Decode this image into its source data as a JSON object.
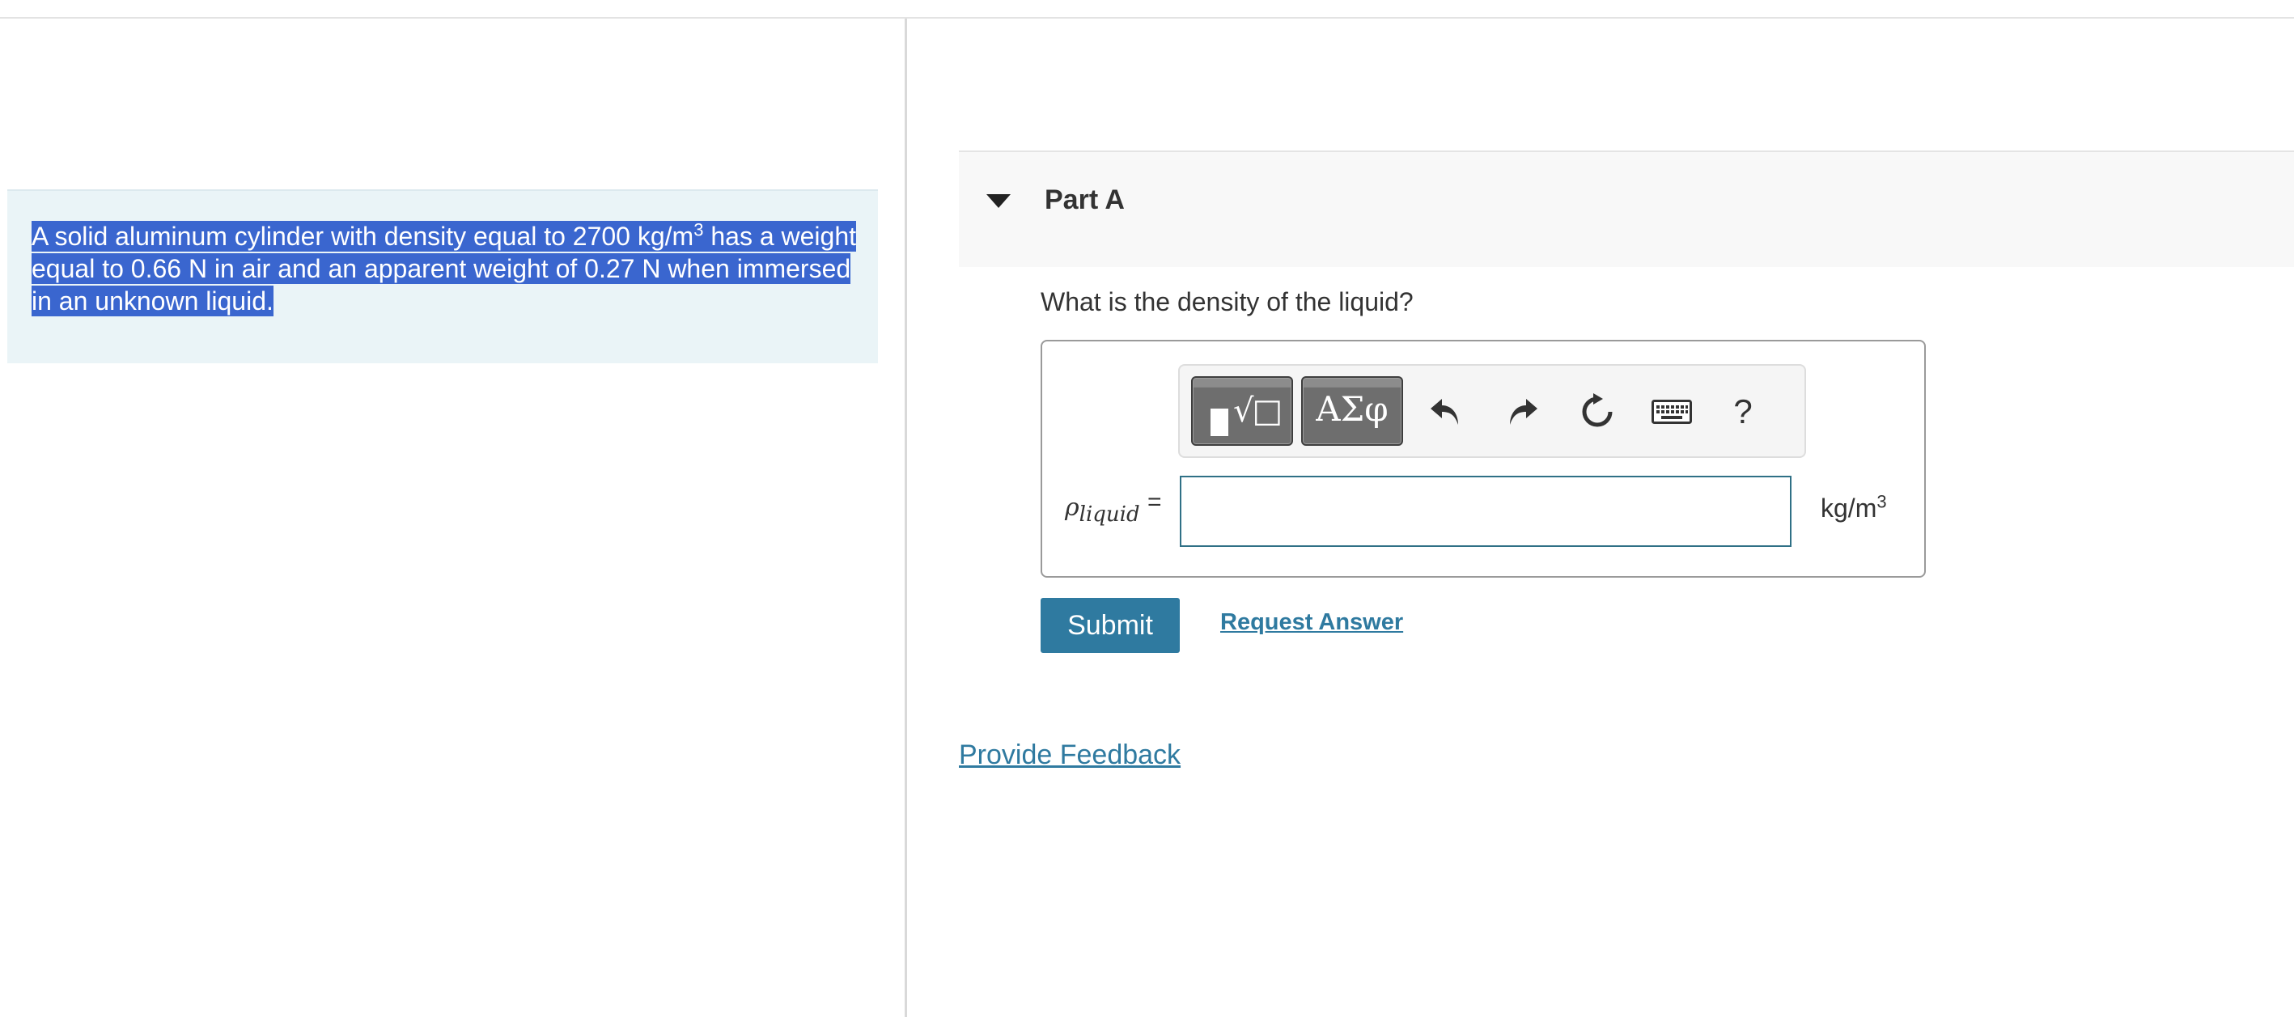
{
  "problem": {
    "text_before_sup": "A solid aluminum cylinder with density equal to 2700 kg/m",
    "sup": "3",
    "text_after_sup": " has a weight equal to 0.66 N in air and an apparent weight of 0.27 N when immersed in an unknown liquid."
  },
  "part": {
    "title": "Part A"
  },
  "question": "What is the density of the liquid?",
  "toolbar": {
    "greek_label": "ΑΣφ",
    "help_label": "?",
    "icons": [
      "templates-icon",
      "greek-symbols-icon",
      "undo-icon",
      "redo-icon",
      "reset-icon",
      "keyboard-icon",
      "help-icon"
    ]
  },
  "answer": {
    "variable_symbol": "ρ",
    "variable_subscript": "liquid",
    "equals": "=",
    "value": "",
    "unit_base": "kg/m",
    "unit_sup": "3"
  },
  "actions": {
    "submit_label": "Submit",
    "request_answer_label": "Request Answer"
  },
  "feedback_label": "Provide Feedback",
  "colors": {
    "accent": "#2f7aa0",
    "selection": "#3a66cf",
    "problem_bg": "#eaf4f7"
  }
}
